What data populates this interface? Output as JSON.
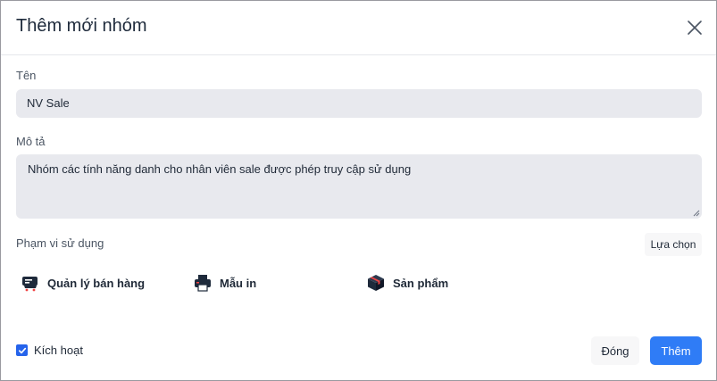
{
  "dialog": {
    "title": "Thêm mới nhóm",
    "close_icon": "close-icon"
  },
  "form": {
    "name_label": "Tên",
    "name_value": "NV Sale",
    "description_label": "Mô tả",
    "description_value": "Nhóm các tính năng danh cho nhân viên sale được phép truy cập sử dụng",
    "scope_label": "Phạm vi sử dụng",
    "choose_button": "Lựa chọn",
    "scopes": [
      {
        "label": "Quản lý bán hàng",
        "icon": "register-icon"
      },
      {
        "label": "Mẫu in",
        "icon": "printer-icon"
      },
      {
        "label": "Sản phẩm",
        "icon": "box-icon"
      }
    ],
    "active_label": "Kích hoạt",
    "active_checked": true
  },
  "footer": {
    "close_button": "Đóng",
    "add_button": "Thêm"
  },
  "colors": {
    "primary": "#2f7cf6",
    "input_bg": "#e8e9ee",
    "scope_icon": "#1e2a3b",
    "scope_accent": "#ef4444"
  }
}
